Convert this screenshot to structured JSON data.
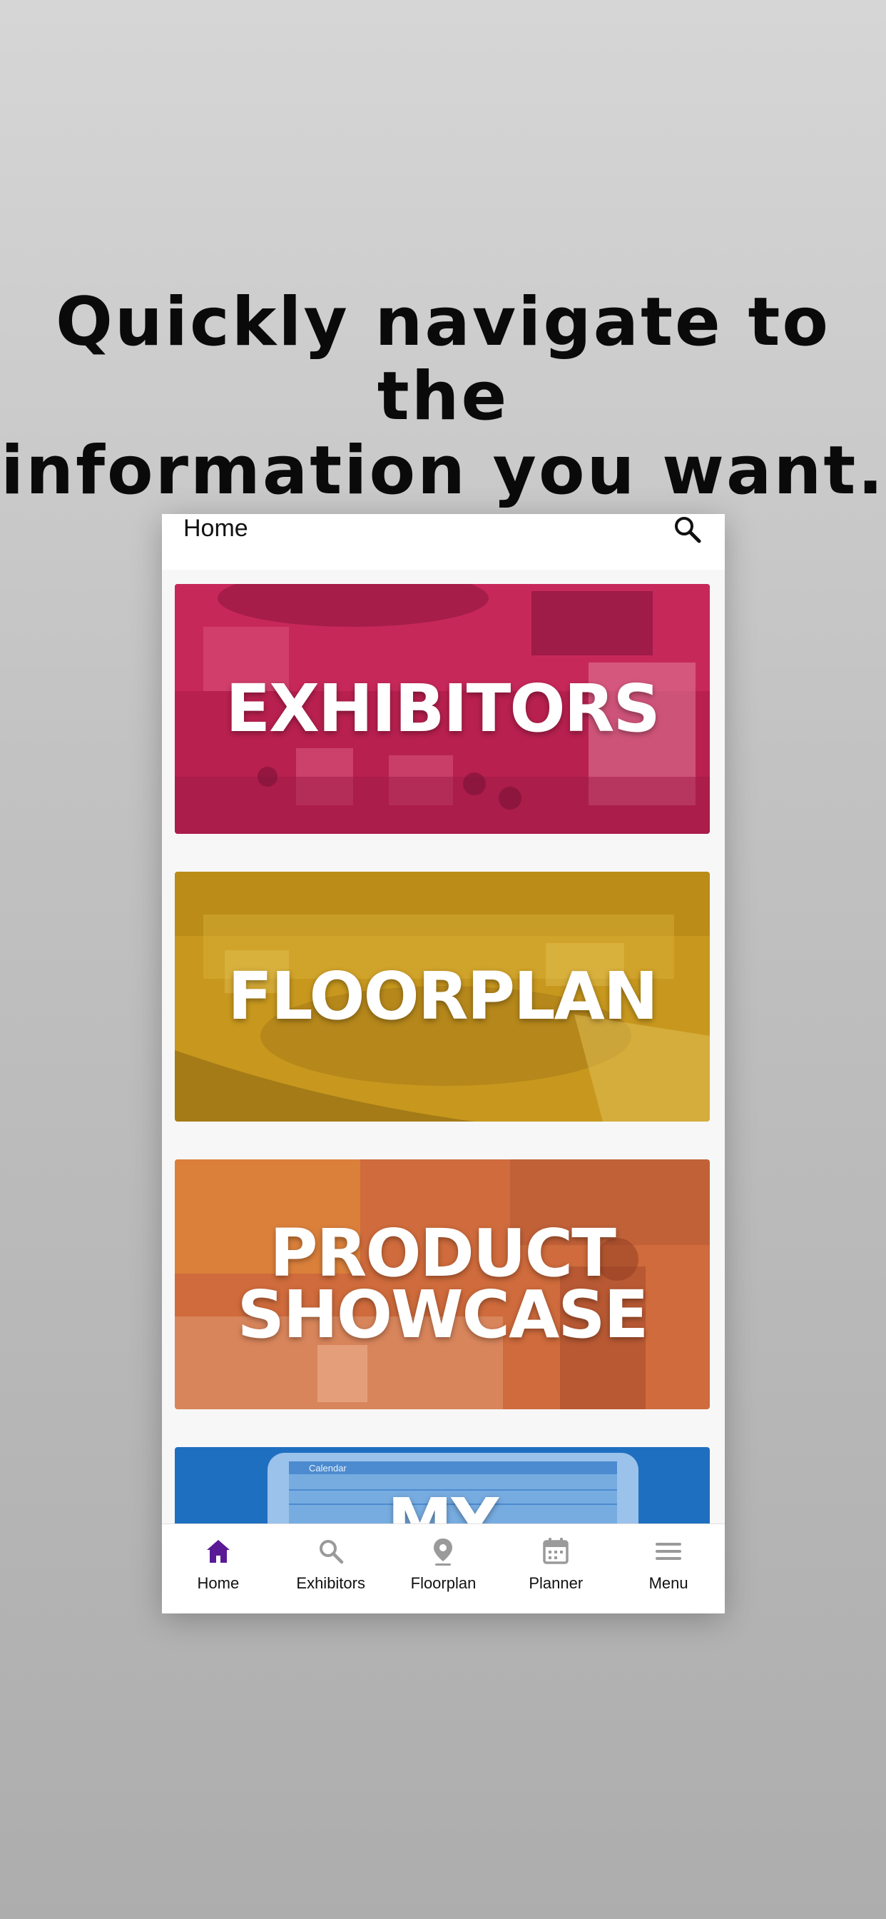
{
  "headline": {
    "line1": "Quickly navigate to the",
    "line2": "information you want."
  },
  "app": {
    "title": "Home",
    "search_icon": "search-icon",
    "tiles": [
      {
        "label": "EXHIBITORS",
        "color": "#c21f55"
      },
      {
        "label": "FLOORPLAN",
        "color": "#c99a1f"
      },
      {
        "label": "PRODUCT\nSHOWCASE",
        "color": "#d06b3c"
      },
      {
        "label": "MY",
        "color": "#1f6fc0"
      }
    ],
    "tabs": [
      {
        "label": "Home",
        "icon": "home-icon",
        "active": true
      },
      {
        "label": "Exhibitors",
        "icon": "search-icon",
        "active": false
      },
      {
        "label": "Floorplan",
        "icon": "map-pin-icon",
        "active": false
      },
      {
        "label": "Planner",
        "icon": "calendar-icon",
        "active": false
      },
      {
        "label": "Menu",
        "icon": "menu-icon",
        "active": false
      }
    ],
    "active_color": "#5a1a96",
    "inactive_color": "#9a9a9a"
  }
}
